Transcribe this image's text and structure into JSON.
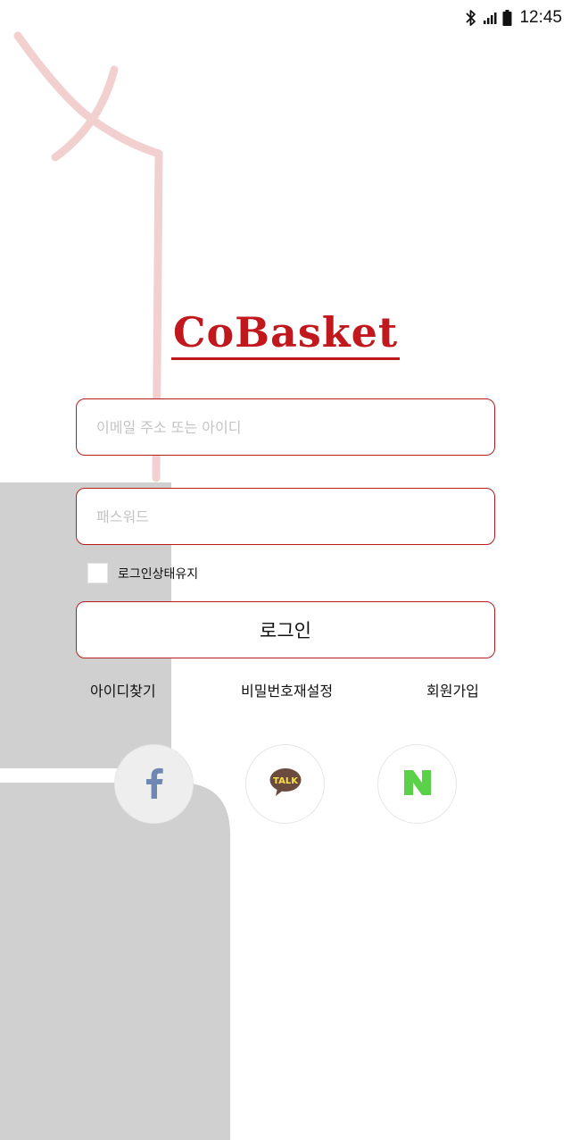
{
  "status_bar": {
    "time": "12:45",
    "icons": [
      "bluetooth-icon",
      "signal-icon",
      "battery-icon"
    ]
  },
  "logo": {
    "text": "CoBasket",
    "color": "#c0181d"
  },
  "login_form": {
    "id_placeholder": "이메일 주소 또는 아이디",
    "id_value": "",
    "password_placeholder": "패스워드",
    "password_value": "",
    "remember_label": "로그인상태유지",
    "remember_checked": false,
    "login_button_label": "로그인"
  },
  "links": {
    "find_id": "아이디찾기",
    "reset_password": "비밀번호재설정",
    "signup": "회원가입"
  },
  "social": {
    "facebook": {
      "icon": "facebook-icon",
      "color": "#6f88b3"
    },
    "kakao": {
      "icon": "kakao-talk-icon",
      "badge_text": "TALK",
      "color": "#6b4b3e"
    },
    "naver": {
      "icon": "naver-icon",
      "color": "#5ad149"
    }
  },
  "colors": {
    "accent": "#b41e22",
    "background_shape": "#d0d0d0",
    "decoration_line": "#f2d0d0"
  }
}
